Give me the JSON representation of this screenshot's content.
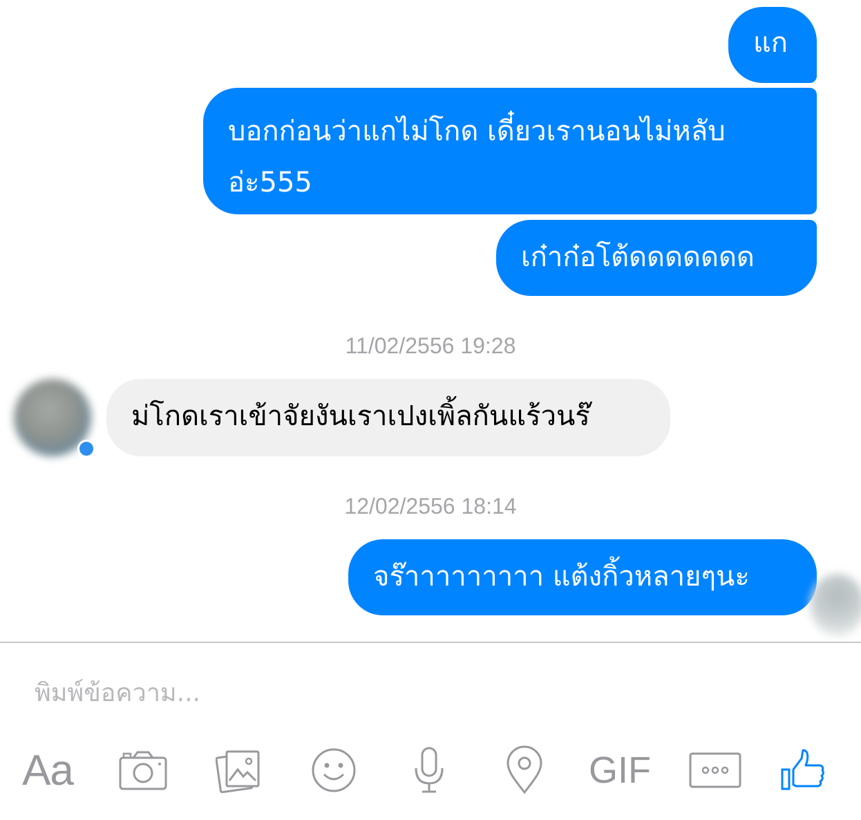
{
  "colors": {
    "outgoing_bubble": "#0084ff",
    "incoming_bubble": "#f1f0f0",
    "timestamp": "#a5a5a9",
    "toolbar_icon": "#98989d",
    "like_icon": "#0084ff"
  },
  "messages": [
    {
      "direction": "outgoing",
      "text": "แก"
    },
    {
      "direction": "outgoing",
      "text_line1": "บอกก่อนว่าแกไม่โกด เดี๋ยวเรานอนไม่หลับ",
      "text_line2": "อ่ะ555"
    },
    {
      "direction": "outgoing",
      "text": "เก๋าก๋อโต้ดดดดดดด"
    },
    {
      "direction": "timestamp",
      "text": "11/02/2556 19:28"
    },
    {
      "direction": "incoming",
      "text": "ม่โกดเราเข้าจัยงันเราเปงเพิ้ลกันแร้วนร๊"
    },
    {
      "direction": "timestamp",
      "text": "12/02/2556 18:14"
    },
    {
      "direction": "outgoing",
      "text": "จร๊าาาาาาาาา แต้งกิ้วหลายๆนะ"
    }
  ],
  "composer": {
    "placeholder": "พิมพ์ข้อความ..."
  },
  "toolbar": {
    "text_button": "Aa",
    "gif_button": "GIF",
    "icons": [
      "text-format-icon",
      "camera-icon",
      "photo-gallery-icon",
      "emoji-icon",
      "microphone-icon",
      "location-pin-icon",
      "gif-icon",
      "more-icon",
      "thumbs-up-icon"
    ]
  }
}
